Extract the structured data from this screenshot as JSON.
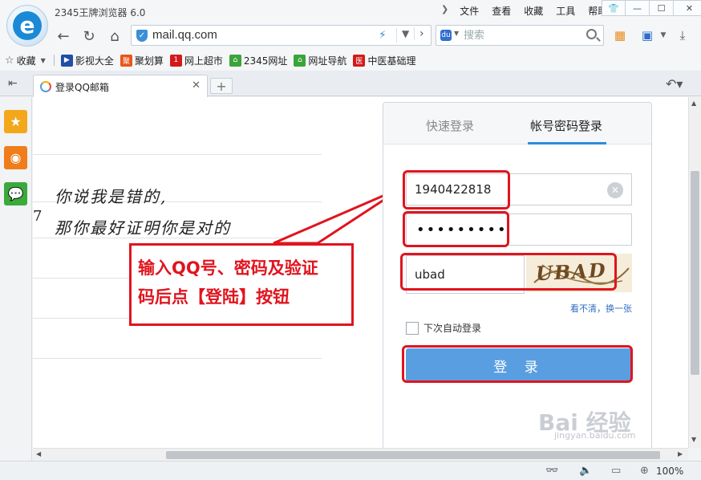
{
  "app": {
    "title": "2345王牌浏览器 6.0"
  },
  "menu": {
    "items": [
      "文件",
      "查看",
      "收藏",
      "工具",
      "帮助"
    ]
  },
  "address": {
    "url": "mail.qq.com"
  },
  "search": {
    "placeholder": "搜索"
  },
  "bookmarks": {
    "favorites": "收藏",
    "items": [
      {
        "label": "影视大全",
        "color": "#1f4fa6"
      },
      {
        "label": "聚划算",
        "color": "#e8561a"
      },
      {
        "label": "网上超市",
        "color": "#d31a1a"
      },
      {
        "label": "2345网址",
        "color": "#3aa43a"
      },
      {
        "label": "网址导航",
        "color": "#3aa43a"
      },
      {
        "label": "中医基础理",
        "color": "#d31a1a"
      }
    ]
  },
  "tab": {
    "label": "登录QQ邮箱"
  },
  "note": {
    "line1": "你说我是错的,",
    "line2": "那你最好证明你是对的"
  },
  "callout": {
    "line1": "输入QQ号、密码及验证",
    "line2": "码后点【登陆】按钮"
  },
  "login": {
    "tab_quick": "快速登录",
    "tab_password": "帐号密码登录",
    "account": "1940422818",
    "password_mask": "•••••••••",
    "captcha_value": "ubad",
    "captcha_text": "UBAD",
    "refresh_link": "看不清，换一张",
    "remember": "下次自动登录",
    "submit": "登 录"
  },
  "watermark": {
    "text": "Bai 经验",
    "sub": "jingyan.baidu.com"
  },
  "status": {
    "zoom": "100%"
  },
  "colors": {
    "accent": "#2e8ddc",
    "highlight": "#e0141e",
    "button": "#5a9ee2"
  }
}
